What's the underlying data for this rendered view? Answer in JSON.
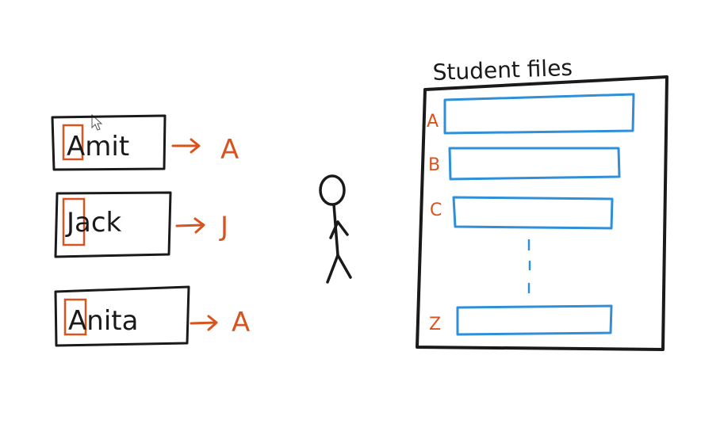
{
  "colors": {
    "ink": "#1a1a1a",
    "highlight": "#d9531e",
    "slot": "#2f8fd8",
    "background": "#ffffff"
  },
  "names": [
    {
      "first": "A",
      "rest": "mit",
      "arrow_label": "A"
    },
    {
      "first": "J",
      "rest": "ack",
      "arrow_label": "J"
    },
    {
      "first": "A",
      "rest": "nita",
      "arrow_label": "A"
    }
  ],
  "cabinet": {
    "title": "Student files",
    "slots": [
      {
        "label": "A"
      },
      {
        "label": "B"
      },
      {
        "label": "C"
      },
      {
        "label": "Z"
      }
    ]
  },
  "icons": [
    "stick-figure-icon",
    "cursor-icon"
  ]
}
